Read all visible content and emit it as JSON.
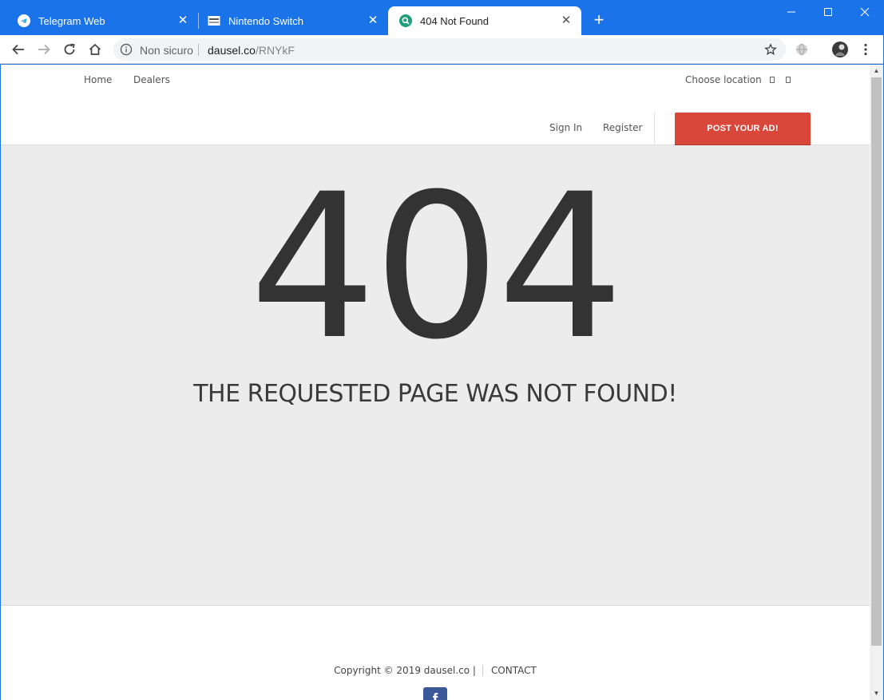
{
  "browser": {
    "tabs": [
      {
        "title": "Telegram Web",
        "icon": "telegram-icon"
      },
      {
        "title": "Nintendo Switch",
        "icon": "page-icon"
      },
      {
        "title": "404 Not Found",
        "icon": "search-favicon",
        "active": true
      }
    ],
    "address": {
      "security_label": "Non sicuro",
      "host": "dausel.co",
      "path": "/RNYkF"
    },
    "accent_color": "#1a73e8"
  },
  "site": {
    "nav": {
      "home": "Home",
      "dealers": "Dealers",
      "choose_location": "Choose location"
    },
    "auth": {
      "sign_in": "Sign In",
      "register": "Register"
    },
    "post_ad_label": "POST YOUR AD!",
    "post_ad_color": "#d8473a",
    "error": {
      "code": "404",
      "message": "THE REQUESTED PAGE WAS NOT FOUND!"
    },
    "footer": {
      "copyright": "Copyright © 2019 dausel.co |",
      "contact": "CONTACT",
      "social_icon": "facebook-icon"
    }
  }
}
